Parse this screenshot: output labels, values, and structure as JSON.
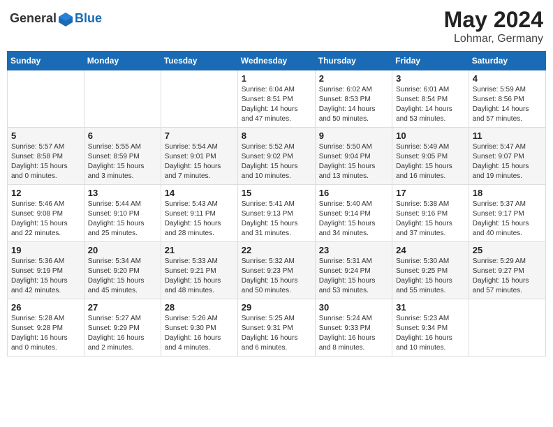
{
  "header": {
    "logo_general": "General",
    "logo_blue": "Blue",
    "month_year": "May 2024",
    "location": "Lohmar, Germany"
  },
  "weekdays": [
    "Sunday",
    "Monday",
    "Tuesday",
    "Wednesday",
    "Thursday",
    "Friday",
    "Saturday"
  ],
  "weeks": [
    [
      null,
      null,
      null,
      {
        "day": "1",
        "sunrise": "6:04 AM",
        "sunset": "8:51 PM",
        "daylight": "14 hours and 47 minutes."
      },
      {
        "day": "2",
        "sunrise": "6:02 AM",
        "sunset": "8:53 PM",
        "daylight": "14 hours and 50 minutes."
      },
      {
        "day": "3",
        "sunrise": "6:01 AM",
        "sunset": "8:54 PM",
        "daylight": "14 hours and 53 minutes."
      },
      {
        "day": "4",
        "sunrise": "5:59 AM",
        "sunset": "8:56 PM",
        "daylight": "14 hours and 57 minutes."
      }
    ],
    [
      {
        "day": "5",
        "sunrise": "5:57 AM",
        "sunset": "8:58 PM",
        "daylight": "15 hours and 0 minutes."
      },
      {
        "day": "6",
        "sunrise": "5:55 AM",
        "sunset": "8:59 PM",
        "daylight": "15 hours and 3 minutes."
      },
      {
        "day": "7",
        "sunrise": "5:54 AM",
        "sunset": "9:01 PM",
        "daylight": "15 hours and 7 minutes."
      },
      {
        "day": "8",
        "sunrise": "5:52 AM",
        "sunset": "9:02 PM",
        "daylight": "15 hours and 10 minutes."
      },
      {
        "day": "9",
        "sunrise": "5:50 AM",
        "sunset": "9:04 PM",
        "daylight": "15 hours and 13 minutes."
      },
      {
        "day": "10",
        "sunrise": "5:49 AM",
        "sunset": "9:05 PM",
        "daylight": "15 hours and 16 minutes."
      },
      {
        "day": "11",
        "sunrise": "5:47 AM",
        "sunset": "9:07 PM",
        "daylight": "15 hours and 19 minutes."
      }
    ],
    [
      {
        "day": "12",
        "sunrise": "5:46 AM",
        "sunset": "9:08 PM",
        "daylight": "15 hours and 22 minutes."
      },
      {
        "day": "13",
        "sunrise": "5:44 AM",
        "sunset": "9:10 PM",
        "daylight": "15 hours and 25 minutes."
      },
      {
        "day": "14",
        "sunrise": "5:43 AM",
        "sunset": "9:11 PM",
        "daylight": "15 hours and 28 minutes."
      },
      {
        "day": "15",
        "sunrise": "5:41 AM",
        "sunset": "9:13 PM",
        "daylight": "15 hours and 31 minutes."
      },
      {
        "day": "16",
        "sunrise": "5:40 AM",
        "sunset": "9:14 PM",
        "daylight": "15 hours and 34 minutes."
      },
      {
        "day": "17",
        "sunrise": "5:38 AM",
        "sunset": "9:16 PM",
        "daylight": "15 hours and 37 minutes."
      },
      {
        "day": "18",
        "sunrise": "5:37 AM",
        "sunset": "9:17 PM",
        "daylight": "15 hours and 40 minutes."
      }
    ],
    [
      {
        "day": "19",
        "sunrise": "5:36 AM",
        "sunset": "9:19 PM",
        "daylight": "15 hours and 42 minutes."
      },
      {
        "day": "20",
        "sunrise": "5:34 AM",
        "sunset": "9:20 PM",
        "daylight": "15 hours and 45 minutes."
      },
      {
        "day": "21",
        "sunrise": "5:33 AM",
        "sunset": "9:21 PM",
        "daylight": "15 hours and 48 minutes."
      },
      {
        "day": "22",
        "sunrise": "5:32 AM",
        "sunset": "9:23 PM",
        "daylight": "15 hours and 50 minutes."
      },
      {
        "day": "23",
        "sunrise": "5:31 AM",
        "sunset": "9:24 PM",
        "daylight": "15 hours and 53 minutes."
      },
      {
        "day": "24",
        "sunrise": "5:30 AM",
        "sunset": "9:25 PM",
        "daylight": "15 hours and 55 minutes."
      },
      {
        "day": "25",
        "sunrise": "5:29 AM",
        "sunset": "9:27 PM",
        "daylight": "15 hours and 57 minutes."
      }
    ],
    [
      {
        "day": "26",
        "sunrise": "5:28 AM",
        "sunset": "9:28 PM",
        "daylight": "16 hours and 0 minutes."
      },
      {
        "day": "27",
        "sunrise": "5:27 AM",
        "sunset": "9:29 PM",
        "daylight": "16 hours and 2 minutes."
      },
      {
        "day": "28",
        "sunrise": "5:26 AM",
        "sunset": "9:30 PM",
        "daylight": "16 hours and 4 minutes."
      },
      {
        "day": "29",
        "sunrise": "5:25 AM",
        "sunset": "9:31 PM",
        "daylight": "16 hours and 6 minutes."
      },
      {
        "day": "30",
        "sunrise": "5:24 AM",
        "sunset": "9:33 PM",
        "daylight": "16 hours and 8 minutes."
      },
      {
        "day": "31",
        "sunrise": "5:23 AM",
        "sunset": "9:34 PM",
        "daylight": "16 hours and 10 minutes."
      },
      null
    ]
  ]
}
